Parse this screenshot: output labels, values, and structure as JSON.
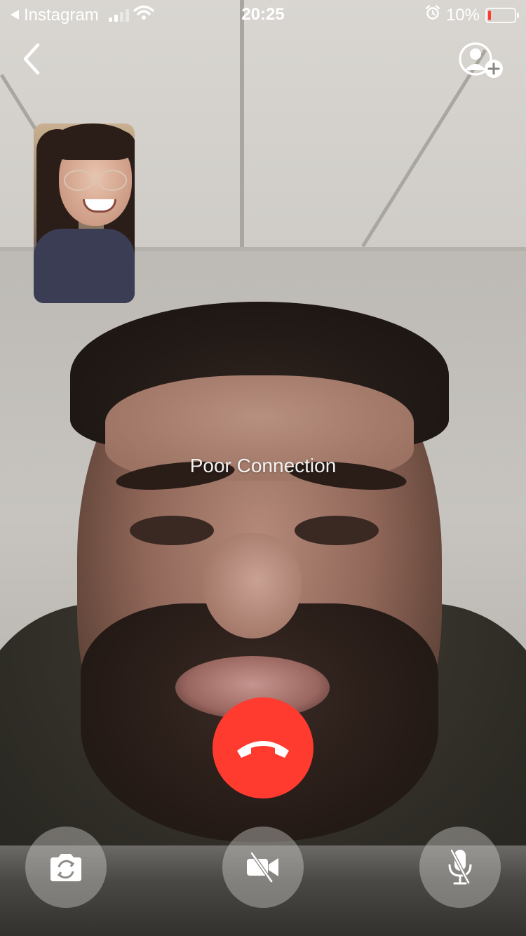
{
  "status_bar": {
    "back_app_label": "Instagram",
    "time": "20:25",
    "battery_percent_label": "10%",
    "battery_level": 0.1,
    "signal_bars_active": 2,
    "signal_bars_total": 4
  },
  "call": {
    "connection_status": "Poor Connection"
  },
  "colors": {
    "end_call": "#ff3b30",
    "battery_low": "#ff3b30",
    "control_bg": "rgba(210,208,205,0.42)"
  },
  "icons": {
    "back": "chevron-left-icon",
    "add_person": "add-person-icon",
    "end_call": "phone-hangup-icon",
    "flip_camera": "flip-camera-icon",
    "video_off": "video-off-icon",
    "mic_off": "mic-off-icon"
  }
}
